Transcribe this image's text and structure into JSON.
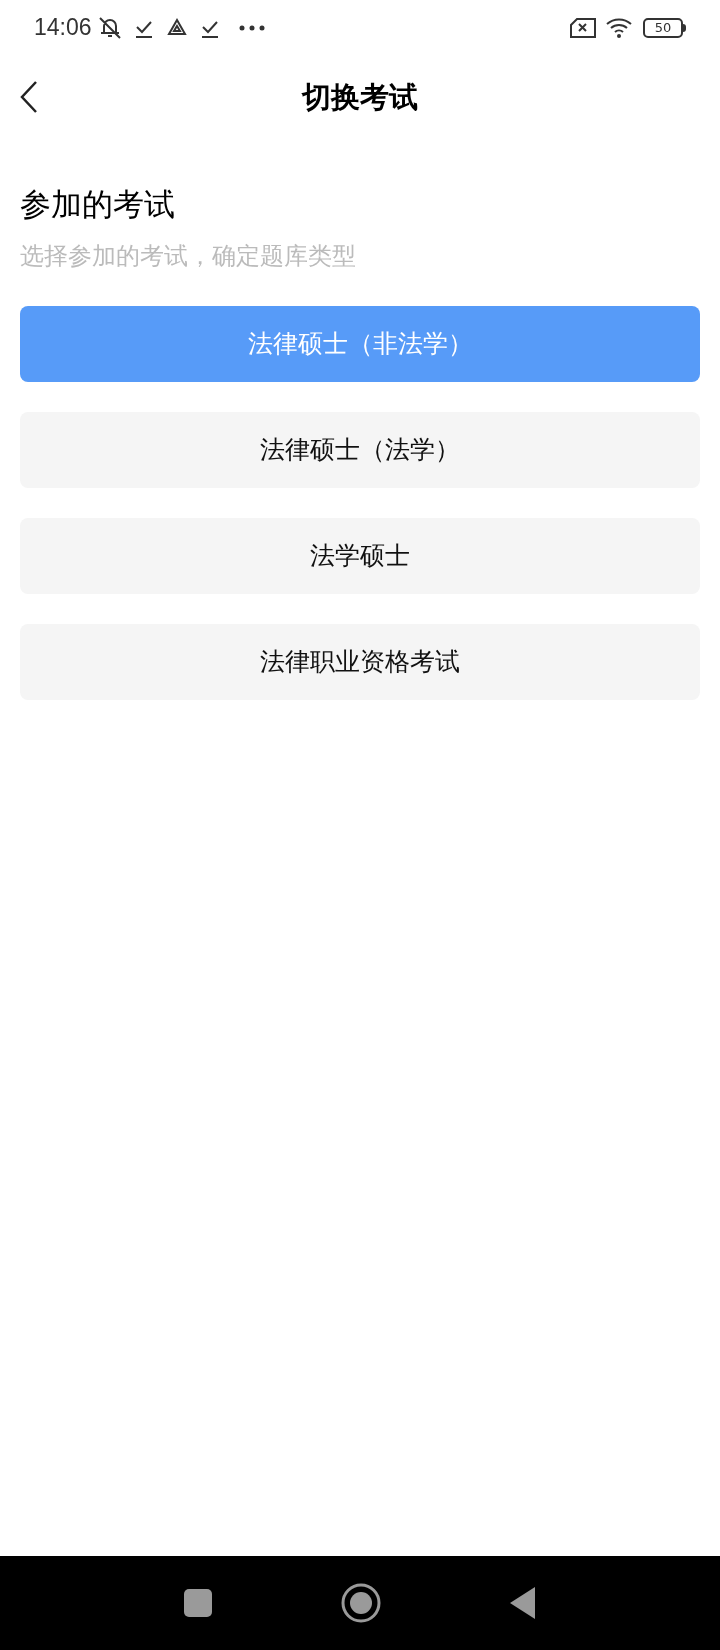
{
  "status_bar": {
    "time": "14:06",
    "battery": "50"
  },
  "header": {
    "title": "切换考试"
  },
  "section": {
    "title": "参加的考试",
    "subtitle": "选择参加的考试，确定题库类型"
  },
  "exams": [
    {
      "label": "法律硕士（非法学）",
      "selected": true
    },
    {
      "label": "法律硕士（法学）",
      "selected": false
    },
    {
      "label": "法学硕士",
      "selected": false
    },
    {
      "label": "法律职业资格考试",
      "selected": false
    }
  ]
}
